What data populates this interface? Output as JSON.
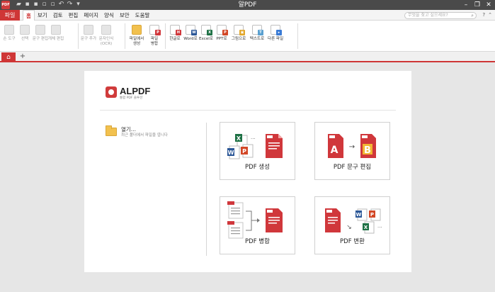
{
  "window": {
    "title": "알PDF",
    "logo_text": "PDF"
  },
  "menu": {
    "file": "파일",
    "items": [
      "홈",
      "보기",
      "검토",
      "편집",
      "페이지",
      "양식",
      "보안",
      "도움말"
    ],
    "active_index": 0,
    "search_placeholder": "무엇을 찾고 싶으세요?"
  },
  "ribbon": {
    "group1": [
      {
        "label": "손 도구",
        "icon": "hand-icon",
        "disabled": true
      },
      {
        "label": "선택",
        "icon": "select-icon",
        "disabled": true
      },
      {
        "label": "문구 편집",
        "icon": "text-edit-icon",
        "disabled": true
      },
      {
        "label": "개체 편집",
        "icon": "object-edit-icon",
        "disabled": true
      }
    ],
    "group2": [
      {
        "label": "문구 추가",
        "icon": "text-add-icon",
        "disabled": true
      },
      {
        "label": "문자인식 (OCR)",
        "icon": "ocr-icon",
        "disabled": true
      }
    ],
    "group3": [
      {
        "label": "파일에서 생성",
        "icon": "folder-icon",
        "disabled": false
      },
      {
        "label": "파일 병합",
        "icon": "merge-icon",
        "disabled": false
      }
    ],
    "group4": [
      {
        "label": "한글로",
        "badge": "H",
        "color": "#2b79c2",
        "icon": "hwp-icon"
      },
      {
        "label": "Word로",
        "badge": "W",
        "color": "#2b5797",
        "icon": "word-icon"
      },
      {
        "label": "Excel로",
        "badge": "X",
        "color": "#1e7145",
        "icon": "excel-icon"
      },
      {
        "label": "PPT로",
        "badge": "P",
        "color": "#d24726",
        "icon": "ppt-icon"
      },
      {
        "label": "그림으로",
        "badge": "▣",
        "color": "#e2a72c",
        "icon": "image-icon"
      },
      {
        "label": "텍스트로",
        "badge": "T",
        "color": "#5aa0d0",
        "icon": "text-icon"
      },
      {
        "label": "다른 파일",
        "badge": "▸",
        "color": "#3a7bd5",
        "icon": "other-file-icon"
      }
    ]
  },
  "brand": {
    "name": "ALPDF",
    "subtitle": "통합 PDF 솔루션"
  },
  "open": {
    "label": "열기...",
    "sub": "최근 폴더에서 파일을 엽니다"
  },
  "cards": {
    "create": "PDF 생성",
    "edit": "PDF 문구 편집",
    "merge": "PDF 병합",
    "convert": "PDF 변환"
  },
  "colors": {
    "accent": "#cf3636",
    "pdf_red": "#d0373b",
    "word_blue": "#2b5797",
    "excel_green": "#1e7145",
    "ppt_orange": "#d24726"
  }
}
